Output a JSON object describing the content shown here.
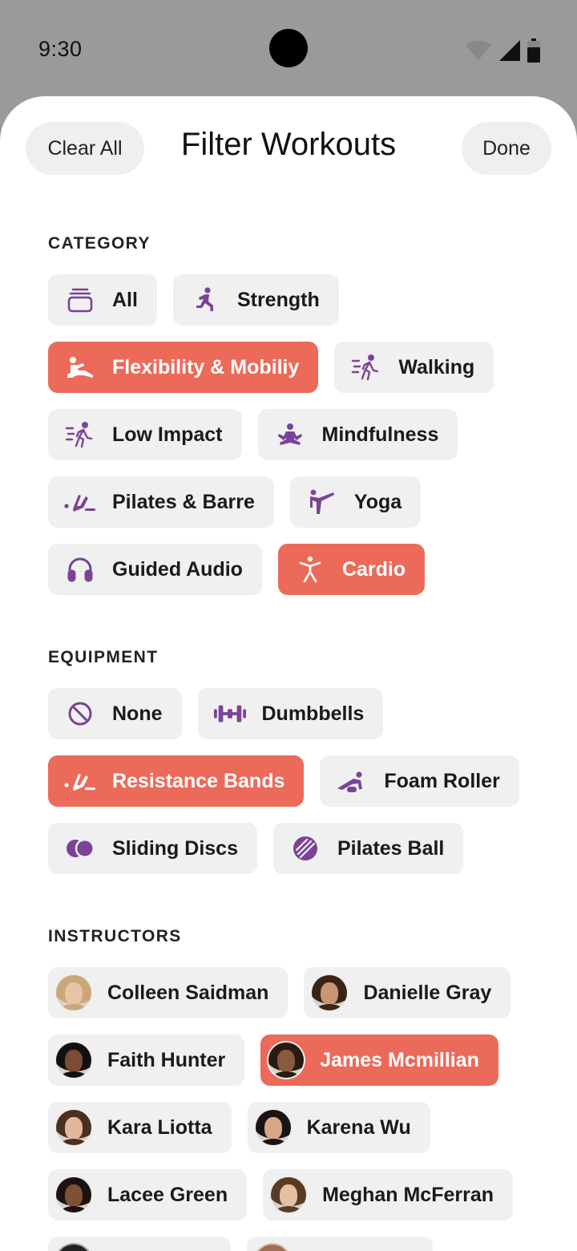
{
  "status_bar": {
    "time": "9:30"
  },
  "header": {
    "clear_label": "Clear All",
    "title": "Filter Workouts",
    "done_label": "Done"
  },
  "colors": {
    "accent": "#ec6a59",
    "icon": "#7b4397",
    "chip_bg": "#f0f0f0"
  },
  "category": {
    "title": "CATEGORY",
    "items": [
      {
        "label": "All",
        "icon": "stack-icon",
        "selected": false
      },
      {
        "label": "Strength",
        "icon": "strength-icon",
        "selected": false
      },
      {
        "label": "Flexibility & Mobiliy",
        "icon": "stretch-icon",
        "selected": true
      },
      {
        "label": "Walking",
        "icon": "walking-icon",
        "selected": false
      },
      {
        "label": "Low Impact",
        "icon": "low-impact-icon",
        "selected": false
      },
      {
        "label": "Mindfulness",
        "icon": "meditation-icon",
        "selected": false
      },
      {
        "label": "Pilates & Barre",
        "icon": "pilates-icon",
        "selected": false
      },
      {
        "label": "Yoga",
        "icon": "yoga-icon",
        "selected": false
      },
      {
        "label": "Guided Audio",
        "icon": "headphones-icon",
        "selected": false
      },
      {
        "label": "Cardio",
        "icon": "cardio-icon",
        "selected": true
      }
    ]
  },
  "equipment": {
    "title": "EQUIPMENT",
    "items": [
      {
        "label": "None",
        "icon": "none-icon",
        "selected": false
      },
      {
        "label": "Dumbbells",
        "icon": "dumbbell-icon",
        "selected": false
      },
      {
        "label": "Resistance Bands",
        "icon": "resistance-band-icon",
        "selected": true
      },
      {
        "label": "Foam Roller",
        "icon": "foam-roller-icon",
        "selected": false
      },
      {
        "label": "Sliding Discs",
        "icon": "sliding-discs-icon",
        "selected": false
      },
      {
        "label": "Pilates Ball",
        "icon": "pilates-ball-icon",
        "selected": false
      }
    ]
  },
  "instructors": {
    "title": "INSTRUCTORS",
    "items": [
      {
        "name": "Colleen Saidman",
        "selected": false,
        "hair": "#c9a77a",
        "skin": "#e8c3a6"
      },
      {
        "name": "Danielle Gray",
        "selected": false,
        "hair": "#3a2416",
        "skin": "#c99676"
      },
      {
        "name": "Faith Hunter",
        "selected": false,
        "hair": "#151010",
        "skin": "#7a4c33"
      },
      {
        "name": "James Mcmillian",
        "selected": true,
        "hair": "#2a1a12",
        "skin": "#8a5a3e"
      },
      {
        "name": "Kara Liotta",
        "selected": false,
        "hair": "#4a3020",
        "skin": "#e3b89a"
      },
      {
        "name": "Karena Wu",
        "selected": false,
        "hair": "#1a1414",
        "skin": "#d8a786"
      },
      {
        "name": "Lacee Green",
        "selected": false,
        "hair": "#1c1212",
        "skin": "#7e5034"
      },
      {
        "name": "Meghan McFerran",
        "selected": false,
        "hair": "#5a3b24",
        "skin": "#e6c0a2"
      }
    ]
  }
}
